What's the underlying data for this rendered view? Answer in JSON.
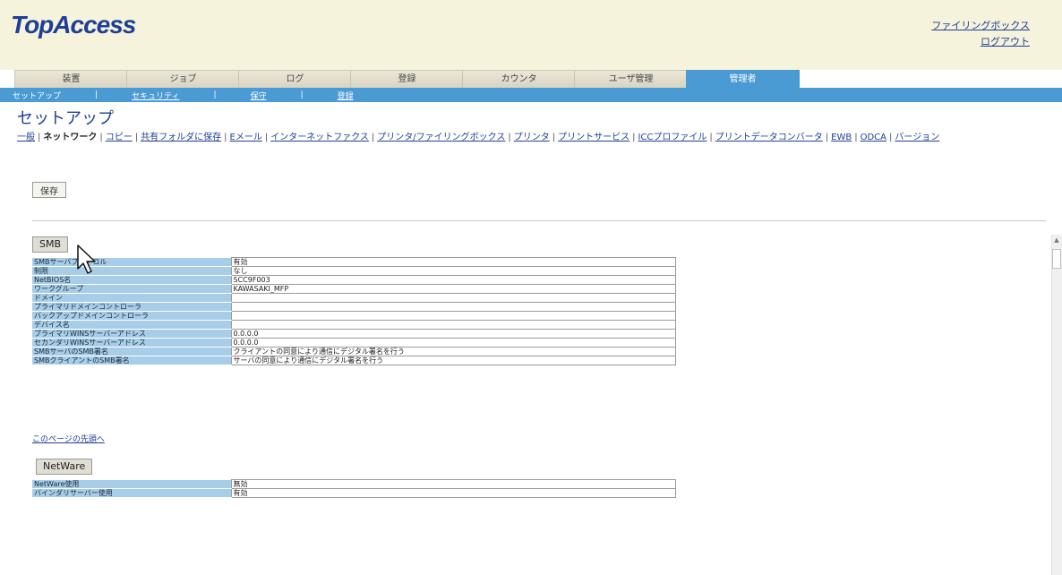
{
  "header": {
    "logo": "TopAccess",
    "filing_box_link": "ファイリングボックス",
    "logout_link": "ログアウト"
  },
  "tabs": [
    {
      "label": "装置",
      "active": false
    },
    {
      "label": "ジョブ",
      "active": false
    },
    {
      "label": "ログ",
      "active": false
    },
    {
      "label": "登録",
      "active": false
    },
    {
      "label": "カウンタ",
      "active": false
    },
    {
      "label": "ユーザ管理",
      "active": false
    },
    {
      "label": "管理者",
      "active": true
    }
  ],
  "subnav": {
    "setup": "セットアップ",
    "security": "セキュリティ",
    "maintenance": "保守",
    "registration": "登録"
  },
  "page": {
    "title": "セットアップ",
    "save_label": "保存",
    "top_link": "このページの先頭へ"
  },
  "func_links": [
    {
      "label": "一般",
      "current": false
    },
    {
      "label": "ネットワーク",
      "current": true
    },
    {
      "label": "コピー",
      "current": false
    },
    {
      "label": "共有フォルダに保存",
      "current": false
    },
    {
      "label": "Eメール",
      "current": false
    },
    {
      "label": "インターネットファクス",
      "current": false
    },
    {
      "label": "プリンタ/ファイリングボックス",
      "current": false
    },
    {
      "label": "プリンタ",
      "current": false
    },
    {
      "label": "プリントサービス",
      "current": false
    },
    {
      "label": "ICCプロファイル",
      "current": false
    },
    {
      "label": "プリントデータコンバータ",
      "current": false
    },
    {
      "label": "EWB",
      "current": false
    },
    {
      "label": "ODCA",
      "current": false
    },
    {
      "label": "バージョン",
      "current": false
    }
  ],
  "smb": {
    "title": "SMB",
    "rows": [
      {
        "label": "SMBサーバプロトコル",
        "value": "有効"
      },
      {
        "label": "制限",
        "value": "なし"
      },
      {
        "label": "NetBIOS名",
        "value": "SCC9F003"
      },
      {
        "label": "ワークグループ",
        "value": "KAWASAKI_MFP"
      },
      {
        "label": "ドメイン",
        "value": ""
      },
      {
        "label": "プライマリドメインコントローラ",
        "value": ""
      },
      {
        "label": "バックアップドメインコントローラ",
        "value": ""
      },
      {
        "label": "デバイス名",
        "value": ""
      },
      {
        "label": "プライマリWINSサーバーアドレス",
        "value": "0.0.0.0"
      },
      {
        "label": "セカンダリWINSサーバーアドレス",
        "value": "0.0.0.0"
      },
      {
        "label": "SMBサーバのSMB署名",
        "value": "クライアントの同意により通信にデジタル署名を行う"
      },
      {
        "label": "SMBクライアントのSMB署名",
        "value": "サーバの同意により通信にデジタル署名を行う"
      }
    ]
  },
  "netware": {
    "title": "NetWare",
    "rows": [
      {
        "label": "NetWare使用",
        "value": "無効"
      },
      {
        "label": "バインダリサーバー使用",
        "value": "有効"
      }
    ]
  },
  "colors": {
    "accent": "#4a9ad4",
    "header_bg": "#f6f3dc",
    "label_bg": "#a7cde8",
    "link": "#1e3f94"
  },
  "icons": [
    "mouse-cursor-icon",
    "scroll-up-icon"
  ]
}
